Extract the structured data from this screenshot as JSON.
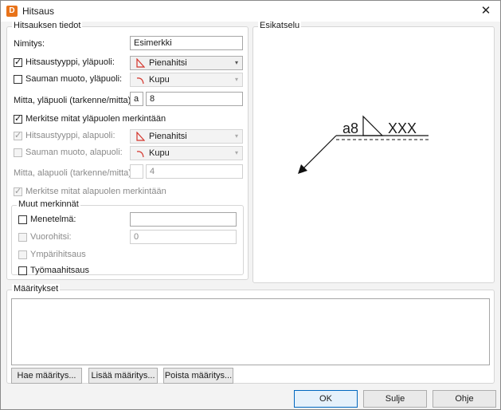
{
  "window": {
    "app_icon_letter": "D",
    "title": "Hitsaus"
  },
  "details": {
    "group_title": "Hitsauksen tiedot",
    "name_label": "Nimitys:",
    "name_value": "Esimerkki",
    "upper_type_label": "Hitsaustyyppi, yläpuoli:",
    "upper_type_checked": true,
    "upper_type_value": "Pienahitsi",
    "upper_shape_label": "Sauman muoto, yläpuoli:",
    "upper_shape_checked": false,
    "upper_shape_value": "Kupu",
    "upper_size_label": "Mitta, yläpuoli (tarkenne/mitta):",
    "upper_size_prefix": "a",
    "upper_size_value": "8",
    "mark_upper_label": "Merkitse mitat yläpuolen merkintään",
    "mark_upper_checked": true,
    "lower_type_label": "Hitsaustyyppi, alapuoli:",
    "lower_type_checked": true,
    "lower_type_value": "Pienahitsi",
    "lower_shape_label": "Sauman muoto, alapuoli:",
    "lower_shape_checked": false,
    "lower_shape_value": "Kupu",
    "lower_size_label": "Mitta, alapuoli (tarkenne/mitta):",
    "lower_size_prefix": "",
    "lower_size_value": "4",
    "mark_lower_label": "Merkitse mitat alapuolen merkintään",
    "mark_lower_checked": true
  },
  "other": {
    "group_title": "Muut merkinnät",
    "method_label": "Menetelmä:",
    "method_value": "",
    "alt_label": "Vuorohitsi:",
    "alt_value": "0",
    "around_label": "Ympärihitsaus",
    "site_label": "Työmaahitsaus"
  },
  "preview": {
    "group_title": "Esikatselu",
    "size_text": "a8",
    "length_text": "XXX"
  },
  "definitions": {
    "group_title": "Määritykset",
    "fetch_label": "Hae määritys...",
    "add_label": "Lisää määritys...",
    "remove_label": "Poista määritys..."
  },
  "footer": {
    "ok_label": "OK",
    "close_label": "Sulje",
    "help_label": "Ohje"
  },
  "colors": {
    "accent": "#0067c0",
    "weld_icon": "#d4342b"
  }
}
